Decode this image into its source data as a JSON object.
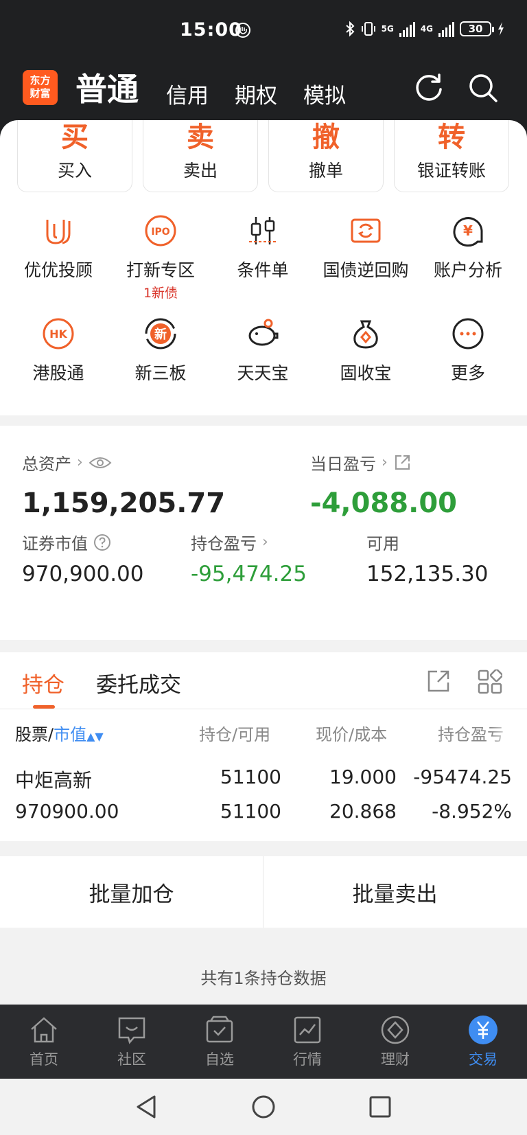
{
  "status": {
    "time": "15:00",
    "net1": "5G",
    "net2": "4G",
    "battery": "30"
  },
  "header": {
    "logo_line1": "东方",
    "logo_line2": "财富",
    "tabs": [
      {
        "label": "普通"
      },
      {
        "label": "信用"
      },
      {
        "label": "期权"
      },
      {
        "label": "模拟"
      }
    ]
  },
  "actions": [
    {
      "char": "买",
      "label": "买入"
    },
    {
      "char": "卖",
      "label": "卖出"
    },
    {
      "char": "撤",
      "label": "撤单"
    },
    {
      "char": "转",
      "label": "银证转账"
    }
  ],
  "grid": [
    {
      "label": "优优投顾",
      "badge": ""
    },
    {
      "label": "打新专区",
      "badge": "1新债",
      "icon_text": "IPO"
    },
    {
      "label": "条件单",
      "badge": ""
    },
    {
      "label": "国债逆回购",
      "badge": ""
    },
    {
      "label": "账户分析",
      "badge": "",
      "icon_text": "¥"
    },
    {
      "label": "港股通",
      "badge": "",
      "icon_text": "HK"
    },
    {
      "label": "新三板",
      "badge": "",
      "icon_text": "新"
    },
    {
      "label": "天天宝",
      "badge": ""
    },
    {
      "label": "固收宝",
      "badge": ""
    },
    {
      "label": "更多",
      "badge": ""
    }
  ],
  "assets": {
    "total_label": "总资产",
    "total_value": "1,159,205.77",
    "daily_label": "当日盈亏",
    "daily_value": "-4,088.00",
    "market_label": "证券市值",
    "market_value": "970,900.00",
    "position_pl_label": "持仓盈亏",
    "position_pl_value": "-95,474.25",
    "available_label": "可用",
    "available_value": "152,135.30"
  },
  "holdings": {
    "tab_active": "持仓",
    "tab_other": "委托成交",
    "col_stock": "股票/",
    "col_sort": "市值",
    "col_qty": "持仓/可用",
    "col_price": "现价/成本",
    "col_pl": "持仓盈亏",
    "rows": [
      {
        "name": "中炬高新",
        "market_value": "970900.00",
        "qty": "51100",
        "avail": "51100",
        "price": "19.000",
        "cost": "20.868",
        "pl": "-95474.25",
        "pl_pct": "-8.952%"
      }
    ]
  },
  "batch": {
    "add": "批量加仓",
    "sell": "批量卖出"
  },
  "footer_note": "共有1条持仓数据",
  "nav": [
    {
      "label": "首页"
    },
    {
      "label": "社区"
    },
    {
      "label": "自选"
    },
    {
      "label": "行情"
    },
    {
      "label": "理财"
    },
    {
      "label": "交易"
    }
  ],
  "colors": {
    "accent": "#f0612a",
    "green": "#2e9e3a",
    "blue": "#3f8df2",
    "dark": "#1f2022"
  }
}
